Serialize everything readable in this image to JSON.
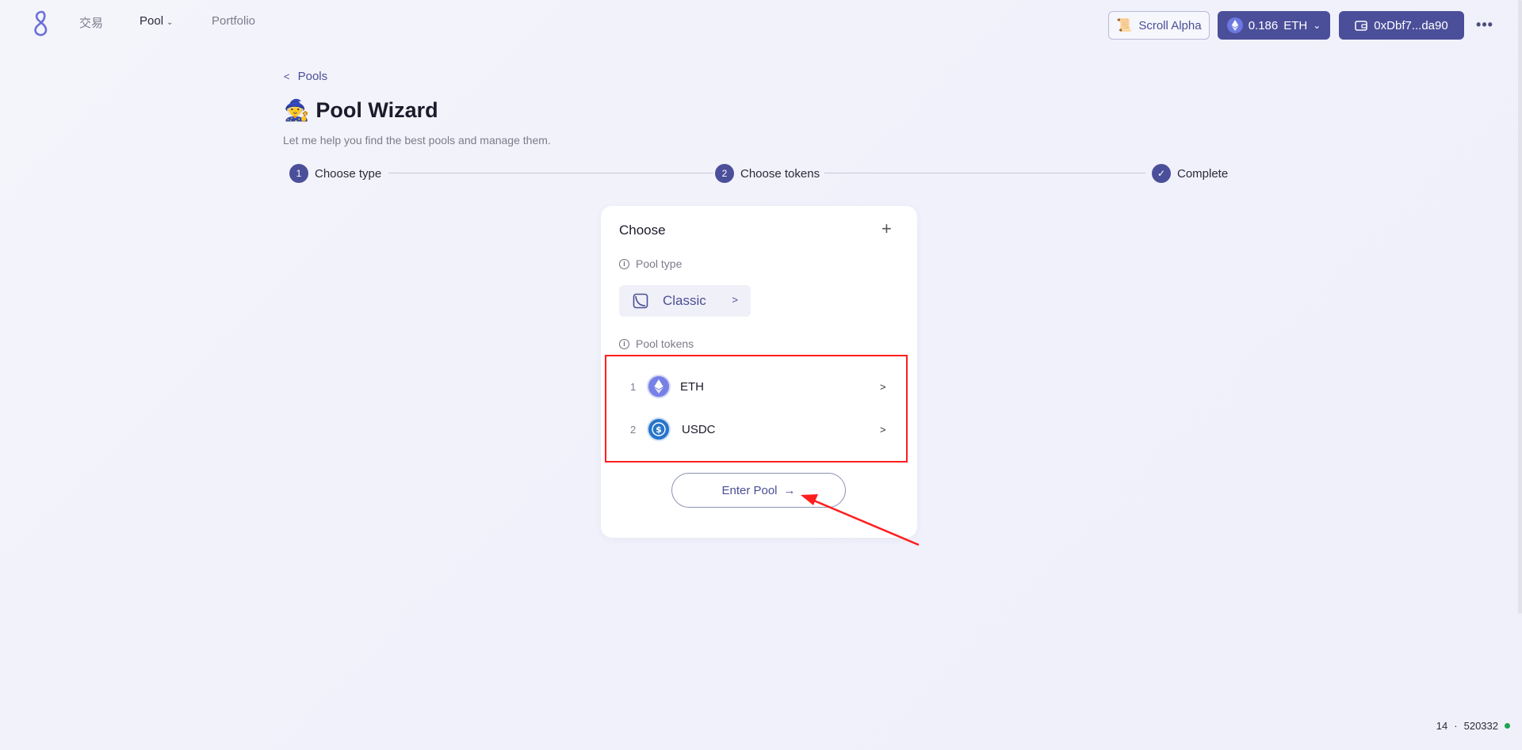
{
  "nav": {
    "trade": "交易",
    "pool": "Pool",
    "portfolio": "Portfolio"
  },
  "header": {
    "network_label": "Scroll Alpha",
    "balance_value": "0.186",
    "balance_unit": "ETH",
    "wallet_address": "0xDbf7...da90"
  },
  "page": {
    "back_label": "Pools",
    "title": "Pool Wizard",
    "subtitle": "Let me help you find the best pools and manage them."
  },
  "stepper": {
    "steps": [
      {
        "number": "1",
        "label": "Choose type"
      },
      {
        "number": "2",
        "label": "Choose tokens"
      },
      {
        "number": "✓",
        "label": "Complete"
      }
    ]
  },
  "card": {
    "title": "Choose",
    "pool_type_label": "Pool type",
    "pool_type_value": "Classic",
    "pool_tokens_label": "Pool tokens",
    "tokens": [
      {
        "index": "1",
        "symbol": "ETH",
        "icon": "eth-icon"
      },
      {
        "index": "2",
        "symbol": "USDC",
        "icon": "usdc-icon"
      }
    ],
    "enter_button": "Enter Pool"
  },
  "statusbar": {
    "left_value": "14",
    "separator": "·",
    "block_number": "520332"
  },
  "colors": {
    "accent": "#4b4f9a",
    "highlight_border": "#ff1e1e",
    "status_ok": "#1aa64f"
  }
}
